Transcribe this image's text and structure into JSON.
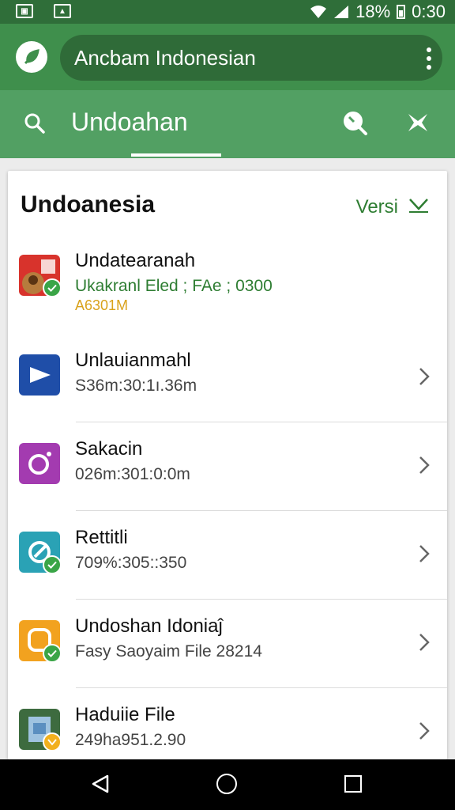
{
  "status_bar": {
    "left_icons": [
      "gallery-icon",
      "notification-icon"
    ],
    "battery": "18%",
    "time": "0:30"
  },
  "app_bar": {
    "title": "Ancbam Indonesian"
  },
  "toolbar": {
    "title": "Undoahan"
  },
  "card": {
    "heading": "Undoanesia",
    "link": "Versi"
  },
  "items": [
    {
      "name": "Undatearanah",
      "subtitle": "Ukakranl Eled ; FAe ; 0300",
      "extra": "A6301M",
      "icon_color": "#d8332c",
      "subtitle_color": "#2e7d32",
      "badge": "check"
    },
    {
      "name": "Unlauianmahl",
      "subtitle": "S36m:30:1ı.36m",
      "icon_color": "#1f4ea8"
    },
    {
      "name": "Sakacin",
      "subtitle": "026m:301:0:0m",
      "icon_color": "#a33bb0"
    },
    {
      "name": "Rettitli",
      "subtitle": "709%:305::350",
      "icon_color": "#2aa2b5",
      "badge": "check"
    },
    {
      "name": "Undoshan Idoniaĵ",
      "subtitle": "Fasy Saoyaim File 28214",
      "icon_color": "#f2a21f",
      "badge": "check"
    },
    {
      "name": "Haduiie File",
      "subtitle": "249ha951.2.90",
      "icon_color": "#3d6b3f",
      "badge": "warning"
    }
  ],
  "colors": {
    "status_bar": "#2f6e39",
    "app_bar": "#3f8f4c",
    "toolbar": "#52a063",
    "accent": "#2e7d32"
  }
}
